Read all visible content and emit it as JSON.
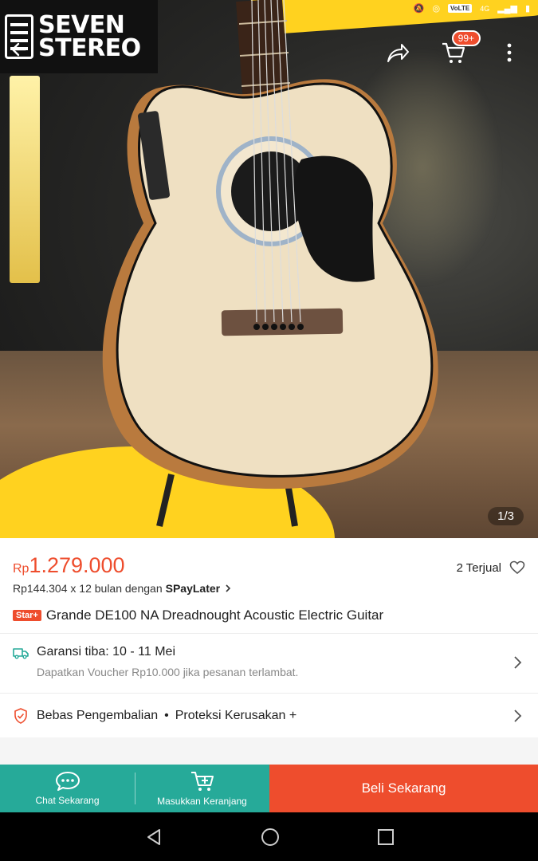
{
  "status_bar": {
    "network_chip": "VoLTE",
    "network_type": "4G"
  },
  "brand": {
    "line1": "SEVEN",
    "line2": "STEREO"
  },
  "header": {
    "cart_badge": "99+"
  },
  "gallery": {
    "pager": "1/3"
  },
  "product": {
    "currency": "Rp",
    "price": "1.279.000",
    "sold": "2 Terjual",
    "installment_text": "Rp144.304 x 12 bulan dengan",
    "installment_brand": "SPayLater",
    "badge": "Star+",
    "title": "Grande DE100 NA Dreadnought Acoustic Electric Guitar"
  },
  "shipping": {
    "title": "Garansi tiba: 10 - 11 Mei",
    "subtitle": "Dapatkan Voucher Rp10.000 jika pesanan terlambat."
  },
  "returns": {
    "item1": "Bebas Pengembalian",
    "separator": "•",
    "item2": "Proteksi Kerusakan +"
  },
  "bottom_bar": {
    "chat_label": "Chat Sekarang",
    "cart_label": "Masukkan Keranjang",
    "buy_label": "Beli Sekarang"
  },
  "colors": {
    "accent": "#ee4d2d",
    "teal": "#26aa99",
    "yellow": "#ffd21f"
  },
  "icons": [
    "back-arrow-icon",
    "share-icon",
    "cart-icon",
    "more-vert-icon",
    "heart-icon",
    "truck-icon",
    "shield-icon",
    "chevron-right-icon",
    "chat-icon",
    "add-to-cart-icon",
    "nav-back-icon",
    "nav-home-icon",
    "nav-recents-icon"
  ]
}
